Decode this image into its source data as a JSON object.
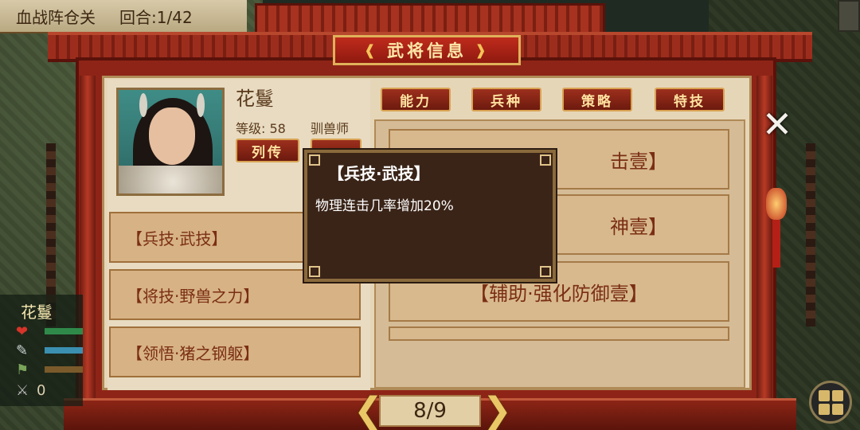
{
  "header": {
    "stage": "血战阵仓关",
    "round_label": "回合:",
    "round": "1/42"
  },
  "title": "武将信息",
  "hero": {
    "name": "花鬘",
    "level_label": "等级:",
    "level": "58",
    "class": "驯兽师"
  },
  "buttons": {
    "biography": "列传",
    "second": "…"
  },
  "tabs": [
    "能力",
    "兵种",
    "策略",
    "特技"
  ],
  "left_skills": [
    "【兵技·武技】",
    "【将技·野兽之力】",
    "【领悟·猪之钢躯】"
  ],
  "right_skills": [
    "击壹】",
    "神壹】",
    "【辅助·强化防御壹】"
  ],
  "tooltip": {
    "title": "【兵技·武技】",
    "description": "物理连击几率增加20%"
  },
  "pager": {
    "page": "8/9"
  },
  "status": {
    "name": "花鬘",
    "count": "0"
  },
  "colors": {
    "frame_red": "#8e2417",
    "gold": "#e0b15a",
    "parchment": "#e6d6b8",
    "tooltip_bg": "#3a2418"
  },
  "icons": [
    "close-icon",
    "prev-arrow-icon",
    "next-arrow-icon",
    "heart-icon",
    "feather-icon",
    "flag-icon",
    "sword-icon",
    "menu-grid-icon",
    "lantern-icon"
  ]
}
